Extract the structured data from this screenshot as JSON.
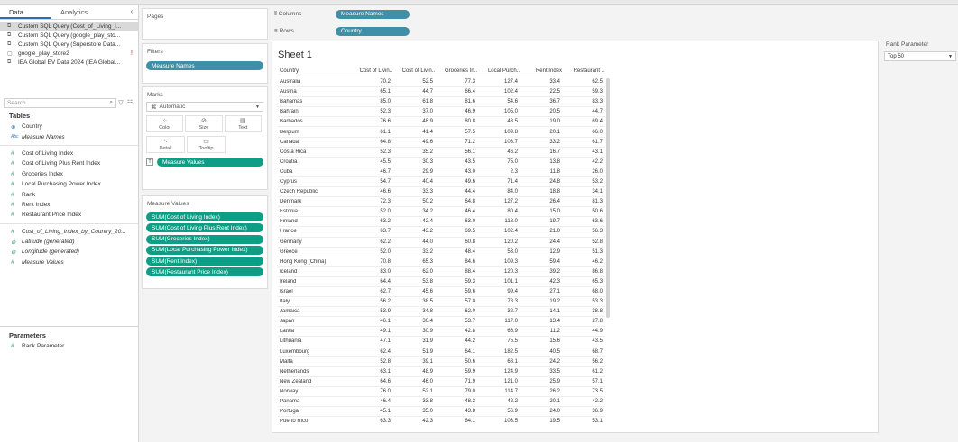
{
  "data_pane": {
    "tab_data": "Data",
    "tab_analytics": "Analytics",
    "collapse": "‹",
    "sources": [
      "Custom SQL Query (Cost_of_Living_I...",
      "Custom SQL Query (google_play_sto...",
      "Custom SQL Query (Superstore Data...",
      "google_play_store2",
      "IEA Global EV Data 2024 (IEA Global..."
    ],
    "warning": "!",
    "search_placeholder": "Search",
    "tables_header": "Tables",
    "fields": [
      {
        "type": "dim",
        "name": "Country"
      },
      {
        "type": "abc",
        "name": "Measure Names"
      },
      {
        "type": "measure",
        "name": "Cost of Living Index"
      },
      {
        "type": "measure",
        "name": "Cost of Living Plus Rent Index"
      },
      {
        "type": "measure",
        "name": "Groceries Index"
      },
      {
        "type": "measure",
        "name": "Local Purchasing Power Index"
      },
      {
        "type": "measure",
        "name": "Rank"
      },
      {
        "type": "measure",
        "name": "Rent Index"
      },
      {
        "type": "measure",
        "name": "Restaurant Price Index"
      },
      {
        "type": "measure",
        "name": "Cost_of_Living_Index_by_Country_20..."
      },
      {
        "type": "geo",
        "name": "Latitude (generated)"
      },
      {
        "type": "geo",
        "name": "Longitude (generated)"
      },
      {
        "type": "measure",
        "name": "Measure Values"
      }
    ],
    "parameters_header": "Parameters",
    "parameter": "Rank Parameter"
  },
  "shelves": {
    "pages_title": "Pages",
    "filters_title": "Filters",
    "filter_pill": "Measure Names",
    "marks_title": "Marks",
    "marks_type": "Automatic",
    "mark_buttons": [
      "Color",
      "Size",
      "Text",
      "Detail",
      "Tooltip"
    ],
    "mark_pill": "Measure Values",
    "measure_values_title": "Measure Values",
    "measure_pills": [
      "SUM(Cost of Living Index)",
      "SUM(Cost of Living Plus Rent Index)",
      "SUM(Groceries Index)",
      "SUM(Local Purchasing Power Index)",
      "SUM(Rent Index)",
      "SUM(Restaurant Price Index)"
    ],
    "columns_label": "Columns",
    "columns_pill": "Measure Names",
    "rows_label": "Rows",
    "rows_pill": "Country"
  },
  "sheet": {
    "title": "Sheet 1",
    "headers": [
      "Country",
      "Cost of Livin..",
      "Cost of Livin..",
      "Groceries In..",
      "Local Purch..",
      "Rent Index",
      "Restaurant .."
    ],
    "rows": [
      [
        "Australia",
        "70.2",
        "52.5",
        "77.3",
        "127.4",
        "33.4",
        "62.5"
      ],
      [
        "Austria",
        "65.1",
        "44.7",
        "66.4",
        "102.4",
        "22.5",
        "59.3"
      ],
      [
        "Bahamas",
        "85.0",
        "61.8",
        "81.6",
        "54.6",
        "36.7",
        "83.3"
      ],
      [
        "Bahrain",
        "52.3",
        "37.0",
        "46.9",
        "105.0",
        "20.5",
        "44.7"
      ],
      [
        "Barbados",
        "76.6",
        "48.9",
        "80.8",
        "43.5",
        "19.0",
        "69.4"
      ],
      [
        "Belgium",
        "61.1",
        "41.4",
        "57.5",
        "109.8",
        "20.1",
        "66.0"
      ],
      [
        "Canada",
        "64.8",
        "49.6",
        "71.2",
        "103.7",
        "33.2",
        "61.7"
      ],
      [
        "Costa Rica",
        "52.3",
        "35.2",
        "56.1",
        "46.2",
        "16.7",
        "43.1"
      ],
      [
        "Croatia",
        "45.5",
        "30.3",
        "43.5",
        "75.0",
        "13.8",
        "42.2"
      ],
      [
        "Cuba",
        "46.7",
        "29.9",
        "43.0",
        "2.3",
        "11.8",
        "26.0"
      ],
      [
        "Cyprus",
        "54.7",
        "40.4",
        "49.6",
        "71.4",
        "24.8",
        "53.2"
      ],
      [
        "Czech Republic",
        "46.6",
        "33.3",
        "44.4",
        "84.0",
        "18.8",
        "34.1"
      ],
      [
        "Denmark",
        "72.3",
        "50.2",
        "64.8",
        "127.2",
        "26.4",
        "81.3"
      ],
      [
        "Estonia",
        "52.0",
        "34.2",
        "46.4",
        "80.4",
        "15.0",
        "50.6"
      ],
      [
        "Finland",
        "63.2",
        "42.4",
        "63.0",
        "118.0",
        "19.7",
        "63.6"
      ],
      [
        "France",
        "63.7",
        "43.2",
        "69.5",
        "102.4",
        "21.0",
        "56.3"
      ],
      [
        "Germany",
        "62.2",
        "44.0",
        "60.8",
        "120.2",
        "24.4",
        "52.8"
      ],
      [
        "Greece",
        "52.0",
        "33.2",
        "48.4",
        "53.0",
        "12.9",
        "51.3"
      ],
      [
        "Hong Kong (China)",
        "70.8",
        "65.3",
        "84.6",
        "109.3",
        "59.4",
        "46.2"
      ],
      [
        "Iceland",
        "83.0",
        "62.0",
        "88.4",
        "120.3",
        "39.2",
        "86.8"
      ],
      [
        "Ireland",
        "64.4",
        "53.8",
        "59.3",
        "101.1",
        "42.3",
        "65.3"
      ],
      [
        "Israel",
        "62.7",
        "45.6",
        "59.6",
        "99.4",
        "27.1",
        "68.0"
      ],
      [
        "Italy",
        "56.2",
        "38.5",
        "57.0",
        "78.3",
        "19.2",
        "53.3"
      ],
      [
        "Jamaica",
        "53.9",
        "34.8",
        "62.0",
        "32.7",
        "14.1",
        "38.8"
      ],
      [
        "Japan",
        "46.1",
        "30.4",
        "53.7",
        "117.0",
        "13.4",
        "27.8"
      ],
      [
        "Latvia",
        "49.1",
        "30.9",
        "42.8",
        "66.9",
        "11.2",
        "44.9"
      ],
      [
        "Lithuania",
        "47.1",
        "31.9",
        "44.2",
        "75.5",
        "15.6",
        "43.5"
      ],
      [
        "Luxembourg",
        "62.4",
        "51.9",
        "64.1",
        "182.5",
        "40.5",
        "68.7"
      ],
      [
        "Malta",
        "52.8",
        "39.1",
        "50.6",
        "68.1",
        "24.2",
        "56.2"
      ],
      [
        "Netherlands",
        "63.1",
        "48.9",
        "59.9",
        "124.9",
        "33.5",
        "61.2"
      ],
      [
        "New Zealand",
        "64.6",
        "46.0",
        "71.9",
        "121.0",
        "25.9",
        "57.1"
      ],
      [
        "Norway",
        "76.0",
        "52.1",
        "79.0",
        "114.7",
        "26.2",
        "73.5"
      ],
      [
        "Panama",
        "46.4",
        "33.8",
        "48.3",
        "42.2",
        "20.1",
        "42.2"
      ],
      [
        "Portugal",
        "45.1",
        "35.0",
        "43.8",
        "56.9",
        "24.0",
        "36.9"
      ],
      [
        "Puerto Rico",
        "63.3",
        "42.3",
        "64.1",
        "103.5",
        "19.5",
        "53.1"
      ]
    ]
  },
  "param_control": {
    "title": "Rank Parameter",
    "value": "Top 50"
  }
}
